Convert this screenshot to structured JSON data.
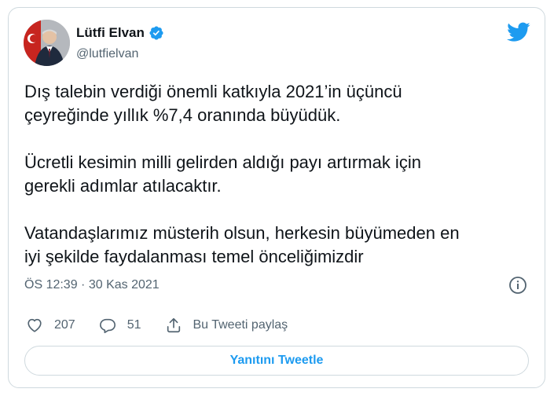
{
  "author": {
    "name": "Lütfi Elvan",
    "handle": "@lutfielvan"
  },
  "tweet": {
    "paragraphs": [
      "Dış talebin verdiği önemli katkıyla 2021’in üçüncü\nçeyreğinde yıllık %7,4 oranında büyüdük.",
      "Ücretli kesimin milli gelirden aldığı payı artırmak için\ngerekli adımlar atılacaktır.",
      "Vatandaşlarımız müsterih olsun, herkesin büyümeden en\niyi şekilde faydalanması temel önceliğimizdir"
    ],
    "timestamp": "ÖS 12:39 · 30 Kas 2021"
  },
  "actions": {
    "like_count": "207",
    "reply_count": "51",
    "share_label": "Bu Tweeti paylaş"
  },
  "reply_button": {
    "label": "Yanıtını Tweetle"
  },
  "colors": {
    "accent": "#1d9bf0",
    "text": "#0f1419",
    "muted": "#536471",
    "border": "#cfd9de"
  },
  "icons": [
    "verified-badge-icon",
    "twitter-bird-icon",
    "info-icon",
    "heart-icon",
    "reply-icon",
    "share-icon"
  ]
}
